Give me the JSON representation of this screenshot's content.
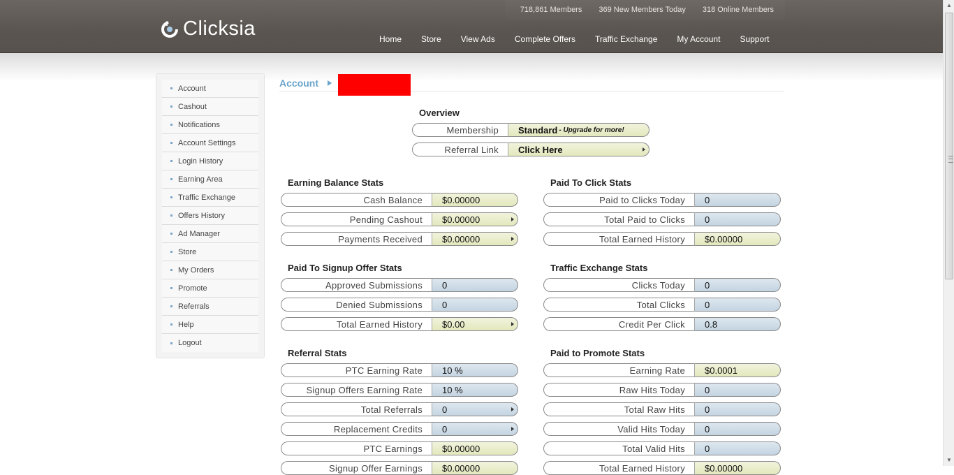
{
  "header": {
    "logo_text": "Clicksia",
    "stats": [
      "718,861 Members",
      "369 New Members Today",
      "318 Online Members"
    ],
    "nav": [
      "Home",
      "Store",
      "View Ads",
      "Complete Offers",
      "Traffic Exchange",
      "My Account",
      "Support"
    ]
  },
  "sidebar": {
    "items": [
      "Account",
      "Cashout",
      "Notifications",
      "Account Settings",
      "Login History",
      "Earning Area",
      "Traffic Exchange",
      "Offers History",
      "Ad Manager",
      "Store",
      "My Orders",
      "Promote",
      "Referrals",
      "Help",
      "Logout"
    ]
  },
  "breadcrumb": {
    "root": "Account"
  },
  "overview": {
    "title": "Overview",
    "membership_label": "Membership",
    "membership_value": "Standard",
    "membership_note": "- Upgrade for more!",
    "referral_label": "Referral Link",
    "referral_value": "Click Here"
  },
  "earning_balance": {
    "title": "Earning Balance Stats",
    "rows": [
      {
        "label": "Cash Balance",
        "value": "$0.00000"
      },
      {
        "label": "Pending Cashout",
        "value": "$0.00000"
      },
      {
        "label": "Payments Received",
        "value": "$0.00000"
      }
    ]
  },
  "ptc_stats": {
    "title": "Paid To Click Stats",
    "rows": [
      {
        "label": "Paid to Clicks Today",
        "value": "0"
      },
      {
        "label": "Total Paid to Clicks",
        "value": "0"
      },
      {
        "label": "Total Earned History",
        "value": "$0.00000"
      }
    ]
  },
  "signup_stats": {
    "title": "Paid To Signup Offer Stats",
    "rows": [
      {
        "label": "Approved Submissions",
        "value": "0"
      },
      {
        "label": "Denied Submissions",
        "value": "0"
      },
      {
        "label": "Total Earned History",
        "value": "$0.00"
      }
    ]
  },
  "te_stats": {
    "title": "Traffic Exchange Stats",
    "rows": [
      {
        "label": "Clicks Today",
        "value": "0"
      },
      {
        "label": "Total Clicks",
        "value": "0"
      },
      {
        "label": "Credit Per Click",
        "value": "0.8"
      }
    ]
  },
  "referral_stats": {
    "title": "Referral Stats",
    "rows": [
      {
        "label": "PTC Earning Rate",
        "value": "10 %"
      },
      {
        "label": "Signup Offers Earning Rate",
        "value": "10 %"
      },
      {
        "label": "Total Referrals",
        "value": "0"
      },
      {
        "label": "Replacement Credits",
        "value": "0"
      },
      {
        "label": "PTC Earnings",
        "value": "$0.00000"
      },
      {
        "label": "Signup Offer Earnings",
        "value": "$0.00000"
      }
    ]
  },
  "promote_stats": {
    "title": "Paid to Promote Stats",
    "rows": [
      {
        "label": "Earning Rate",
        "value": "$0.0001"
      },
      {
        "label": "Raw Hits Today",
        "value": "0"
      },
      {
        "label": "Total Raw Hits",
        "value": "0"
      },
      {
        "label": "Valid Hits Today",
        "value": "0"
      },
      {
        "label": "Total Valid Hits",
        "value": "0"
      },
      {
        "label": "Total Earned History",
        "value": "$0.00000"
      }
    ]
  }
}
